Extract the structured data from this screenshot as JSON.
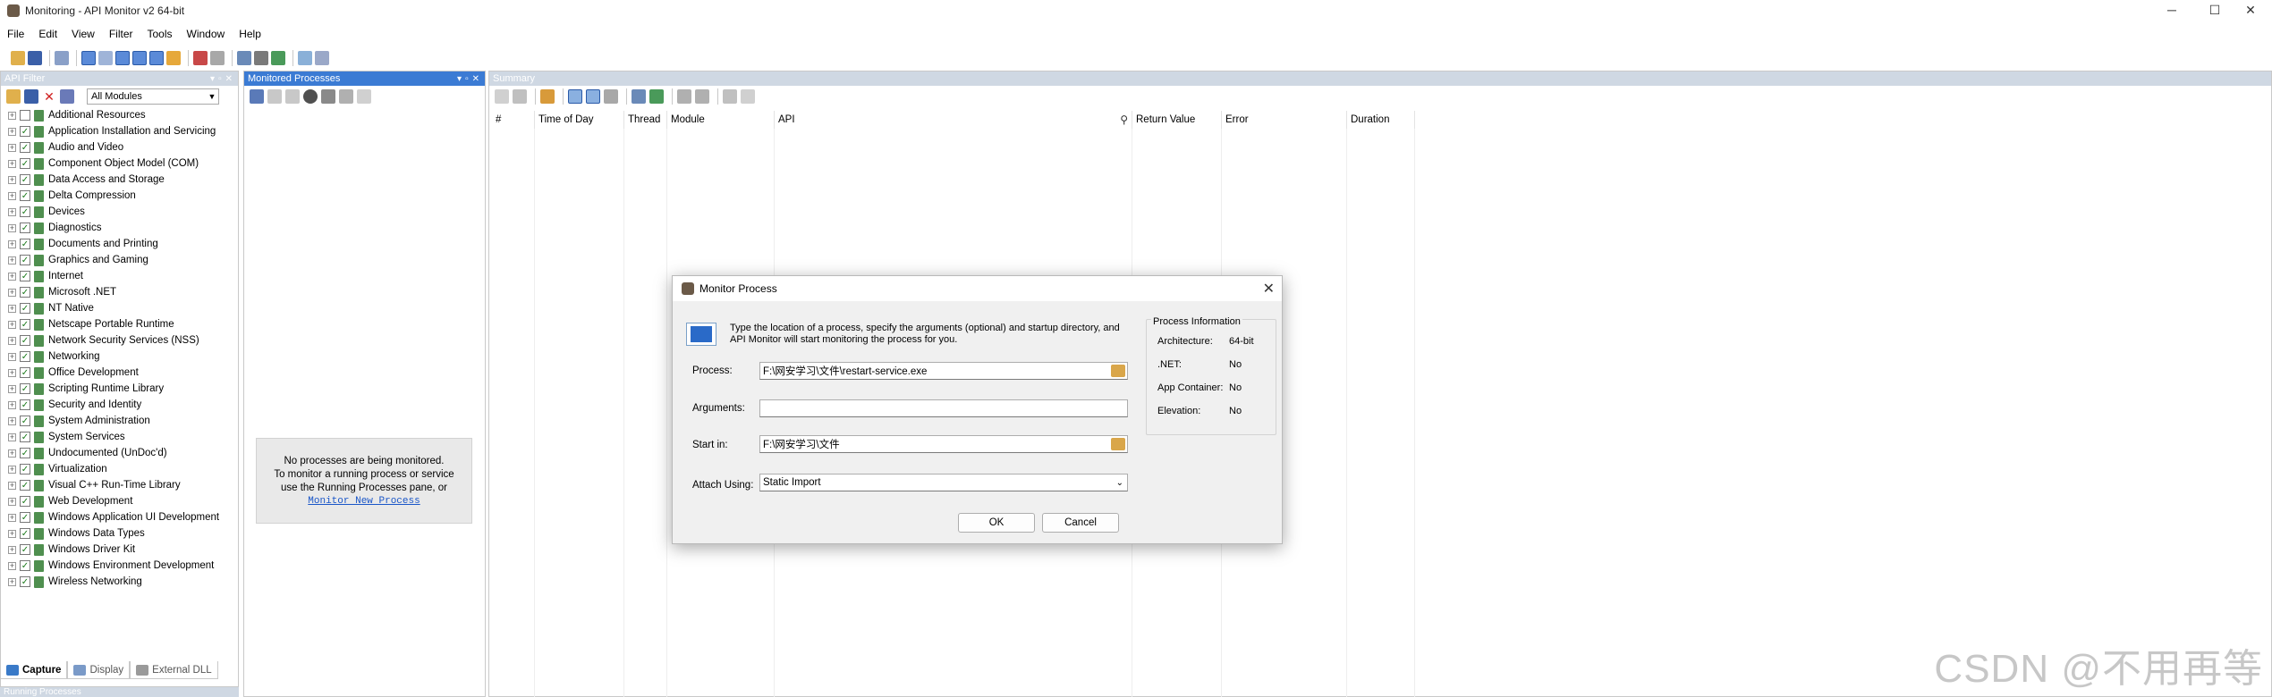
{
  "window": {
    "title": "Monitoring - API Monitor v2 64-bit",
    "minimize": "─",
    "maximize": "☐",
    "close": "✕"
  },
  "menu": [
    "File",
    "Edit",
    "View",
    "Filter",
    "Tools",
    "Window",
    "Help"
  ],
  "api_filter": {
    "title": "API Filter",
    "module_select": "All Modules",
    "items": [
      {
        "label": "Additional Resources",
        "checked": false
      },
      {
        "label": "Application Installation and Servicing",
        "checked": true
      },
      {
        "label": "Audio and Video",
        "checked": true
      },
      {
        "label": "Component Object Model (COM)",
        "checked": true
      },
      {
        "label": "Data Access and Storage",
        "checked": true
      },
      {
        "label": "Delta Compression",
        "checked": true
      },
      {
        "label": "Devices",
        "checked": true
      },
      {
        "label": "Diagnostics",
        "checked": true
      },
      {
        "label": "Documents and Printing",
        "checked": true
      },
      {
        "label": "Graphics and Gaming",
        "checked": true
      },
      {
        "label": "Internet",
        "checked": true
      },
      {
        "label": "Microsoft .NET",
        "checked": true
      },
      {
        "label": "NT Native",
        "checked": true
      },
      {
        "label": "Netscape Portable Runtime",
        "checked": true
      },
      {
        "label": "Network Security Services (NSS)",
        "checked": true
      },
      {
        "label": "Networking",
        "checked": true
      },
      {
        "label": "Office Development",
        "checked": true
      },
      {
        "label": "Scripting Runtime Library",
        "checked": true
      },
      {
        "label": "Security and Identity",
        "checked": true
      },
      {
        "label": "System Administration",
        "checked": true
      },
      {
        "label": "System Services",
        "checked": true
      },
      {
        "label": "Undocumented (UnDoc'd)",
        "checked": true
      },
      {
        "label": "Virtualization",
        "checked": true
      },
      {
        "label": "Visual C++ Run-Time Library",
        "checked": true
      },
      {
        "label": "Web Development",
        "checked": true
      },
      {
        "label": "Windows Application UI Development",
        "checked": true
      },
      {
        "label": "Windows Data Types",
        "checked": true
      },
      {
        "label": "Windows Driver Kit",
        "checked": true
      },
      {
        "label": "Windows Environment Development",
        "checked": true
      },
      {
        "label": "Wireless Networking",
        "checked": true
      }
    ],
    "tabs": [
      "Capture",
      "Display",
      "External DLL"
    ]
  },
  "running_processes": {
    "title": "Running Processes"
  },
  "monitored_processes": {
    "title": "Monitored Processes",
    "empty_line1": "No processes are being monitored.",
    "empty_line2": "To monitor a running process or service",
    "empty_line3": "use the Running Processes pane, or",
    "empty_link": "Monitor New Process"
  },
  "summary": {
    "title": "Summary",
    "columns": [
      "#",
      "Time of Day",
      "Thread",
      "Module",
      "API",
      "Return Value",
      "Error",
      "Duration"
    ]
  },
  "dialog": {
    "title": "Monitor Process",
    "description_line1": "Type the location of a process, specify the arguments (optional) and startup directory, and",
    "description_line2": "API Monitor will start monitoring the process for you.",
    "process_label": "Process:",
    "process_value": "F:\\网安学习\\文件\\restart-service.exe",
    "arguments_label": "Arguments:",
    "arguments_value": "",
    "startin_label": "Start in:",
    "startin_value": "F:\\网安学习\\文件",
    "attach_label": "Attach Using:",
    "attach_value": "Static Import",
    "ok": "OK",
    "cancel": "Cancel",
    "info": {
      "title": "Process Information",
      "architecture_label": "Architecture:",
      "architecture_value": "64-bit",
      "net_label": ".NET:",
      "net_value": "No",
      "appcontainer_label": "App Container:",
      "appcontainer_value": "No",
      "elevation_label": "Elevation:",
      "elevation_value": "No"
    }
  },
  "watermark": "CSDN @不用再等",
  "colors": {
    "active_header": "#3b7bd4",
    "inactive_header": "#cfd8e3",
    "link": "#1a56c8"
  }
}
